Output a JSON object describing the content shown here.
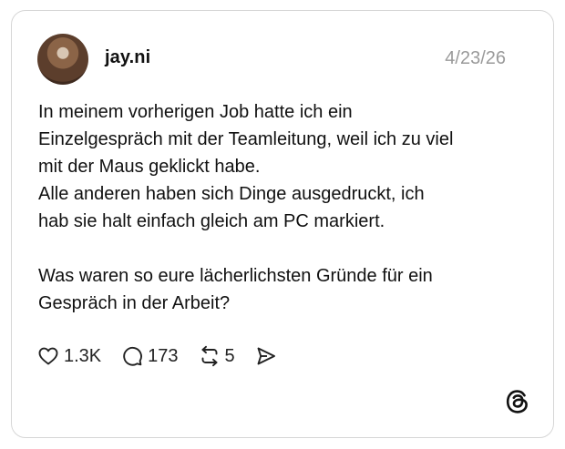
{
  "post": {
    "username": "jay.ni",
    "date": "4/23/26",
    "text_lines": [
      "In meinem vorherigen Job hatte ich ein",
      "Einzelgespräch mit der Teamleitung, weil ich zu viel",
      "mit der Maus geklickt habe.",
      "Alle anderen haben sich Dinge ausgedruckt, ich",
      "hab sie halt einfach gleich am PC markiert.",
      "",
      "Was waren so eure lächerlichsten Gründe für ein",
      "Gespräch in der Arbeit?"
    ]
  },
  "actions": {
    "likes": "1.3K",
    "replies": "173",
    "reposts": "5"
  },
  "icons": {
    "like": "heart-icon",
    "reply": "speech-bubble-icon",
    "repost": "repost-arrows-icon",
    "share": "send-icon",
    "brand": "threads-logo-icon"
  },
  "colors": {
    "text": "#111111",
    "muted": "#9a9a9a",
    "border": "#d6d6d6"
  }
}
